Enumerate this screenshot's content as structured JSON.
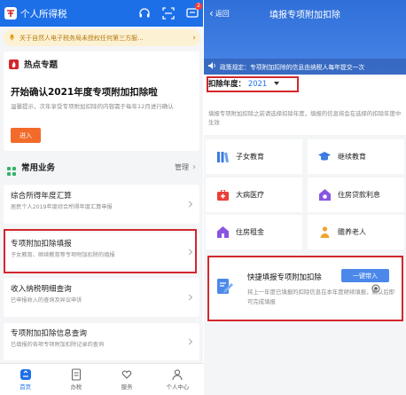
{
  "left": {
    "app_title": "个人所得税",
    "message_badge": "2",
    "notice_text": "关于自然人电子税务局未授权任何第三方服...",
    "hot_topic_label": "热点专题",
    "banner_title": "开始确认2021年度专项附加扣除啦",
    "banner_desc": "温馨提示，次年享受专项附加扣除的内容需于每年12月进行确认",
    "banner_button": "进入",
    "common_label": "常用业务",
    "manage_label": "管理",
    "items": [
      {
        "title": "综合所得年度汇算",
        "sub": "居民个人2019年度综合所得年度汇算申报"
      },
      {
        "title": "专项附加扣除填报",
        "sub": "子女教育、继续教育等专项附加扣除的填报"
      },
      {
        "title": "收入纳税明细查询",
        "sub": "已申报收入的查询及异议申诉"
      },
      {
        "title": "专项附加扣除信息查询",
        "sub": "已填报的各项专项附加扣除记录的查询"
      }
    ],
    "nav": [
      {
        "label": "首页",
        "icon": "home-icon"
      },
      {
        "label": "办税",
        "icon": "document-icon"
      },
      {
        "label": "服务",
        "icon": "heart-hand-icon"
      },
      {
        "label": "个人中心",
        "icon": "person-icon"
      }
    ]
  },
  "right": {
    "back_label": "返回",
    "page_title": "填报专项附加扣除",
    "policy_text": "政策规定：专项附加扣除的信息由纳税人每年提交一次",
    "year_label": "扣除年度：",
    "year_value": "2021",
    "hint": "填报专项附加扣除之前请选择扣除年度，填报的信息将会在选择的扣除年度中生效",
    "categories": [
      {
        "label": "子女教育",
        "icon": "book-icon"
      },
      {
        "label": "继续教育",
        "icon": "graduation-cap-icon"
      },
      {
        "label": "大病医疗",
        "icon": "medical-kit-icon"
      },
      {
        "label": "住房贷款利息",
        "icon": "house-loan-icon"
      },
      {
        "label": "住房租金",
        "icon": "house-rent-icon"
      },
      {
        "label": "赡养老人",
        "icon": "elder-icon"
      }
    ],
    "quick_title": "快捷填报专项附加扣除",
    "quick_button": "一键带入",
    "quick_desc": "将上一年度已填报的扣除信息在本年度继续填报，确认后即可完成填报"
  },
  "colors": {
    "brand": "#1d6fe8",
    "highlight": "#d3272c",
    "banner_button": "#f26b2a"
  }
}
